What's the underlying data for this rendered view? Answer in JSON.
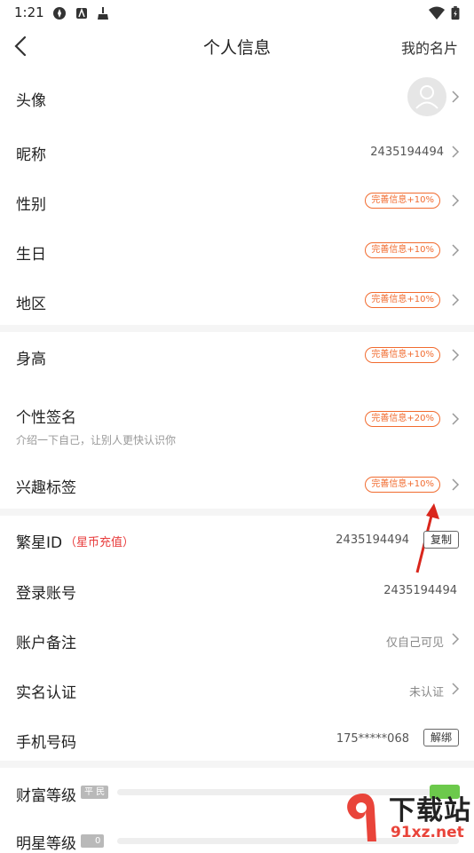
{
  "status_bar": {
    "time": "1:21"
  },
  "header": {
    "title": "个人信息",
    "action": "我的名片"
  },
  "rows": {
    "avatar": {
      "label": "头像"
    },
    "nickname": {
      "label": "昵称",
      "value": "2435194494"
    },
    "gender": {
      "label": "性别",
      "badge": "完善信息+10%"
    },
    "birthday": {
      "label": "生日",
      "badge": "完善信息+10%"
    },
    "region": {
      "label": "地区",
      "badge": "完善信息+10%"
    },
    "height": {
      "label": "身高",
      "badge": "完善信息+10%"
    },
    "signature": {
      "label": "个性签名",
      "sub": "介绍一下自己，让别人更快认识你",
      "badge": "完善信息+20%"
    },
    "interests": {
      "label": "兴趣标签",
      "badge": "完善信息+10%"
    },
    "fanxing_id": {
      "label": "繁星ID",
      "recharge": "（星币充值）",
      "value": "2435194494",
      "copy": "复制"
    },
    "login_account": {
      "label": "登录账号",
      "value": "2435194494"
    },
    "account_note": {
      "label": "账户备注",
      "value": "仅自己可见"
    },
    "real_name": {
      "label": "实名认证",
      "value": "未认证"
    },
    "phone": {
      "label": "手机号码",
      "value": "175*****068",
      "unbind": "解绑"
    },
    "wealth": {
      "label": "财富等级",
      "tag": "平 民"
    },
    "star": {
      "label": "明星等级",
      "tag": "0"
    }
  },
  "watermark": {
    "text": "下载站",
    "url": "91xz.net"
  },
  "colors": {
    "accent": "#f16b2f",
    "recharge": "#e83b3b",
    "arrow": "#d9261c"
  }
}
